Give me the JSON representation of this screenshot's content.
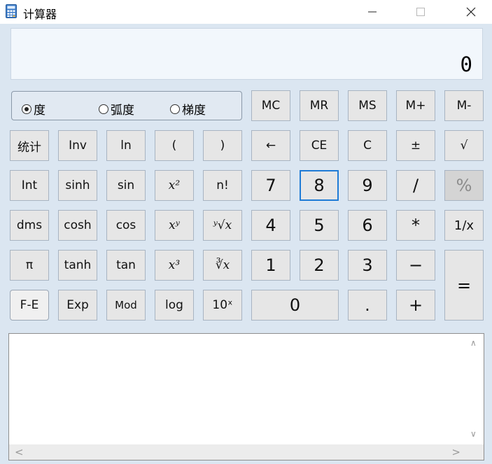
{
  "window": {
    "title": "计算器",
    "minimize_glyph": "—",
    "maximize_glyph": "☐",
    "close_glyph": "✕"
  },
  "display": {
    "value": "0"
  },
  "angle_modes": {
    "selected": "degrees",
    "options": [
      "度",
      "弧度",
      "梯度"
    ]
  },
  "memory_keys": [
    "MC",
    "MR",
    "MS",
    "M+",
    "M-"
  ],
  "rows": {
    "row2": [
      "统计",
      "Inv",
      "ln",
      "(",
      ")",
      "←",
      "CE",
      "C",
      "±",
      "√"
    ],
    "row3": [
      "Int",
      "sinh",
      "sin",
      "x²",
      "n!",
      "7",
      "8",
      "9",
      "/",
      "%"
    ],
    "row4": [
      "dms",
      "cosh",
      "cos",
      "xʸ",
      "ʸ√x",
      "4",
      "5",
      "6",
      "*",
      "1/x"
    ],
    "row5": [
      "π",
      "tanh",
      "tan",
      "x³",
      "∛x",
      "1",
      "2",
      "3",
      "−",
      "="
    ],
    "row6": [
      "F-E",
      "Exp",
      "Mod",
      "log",
      "10ˣ",
      "0",
      ".",
      "+"
    ]
  },
  "history": {
    "up_arrow": "∧",
    "down_arrow": "∨",
    "left_arrow": "<",
    "right_arrow": ">"
  },
  "colors": {
    "frame": "#dbe6f1",
    "display_bg": "#f2f7fc",
    "key_bg": "#e6e6e6",
    "focus_border": "#1f7bd6"
  }
}
